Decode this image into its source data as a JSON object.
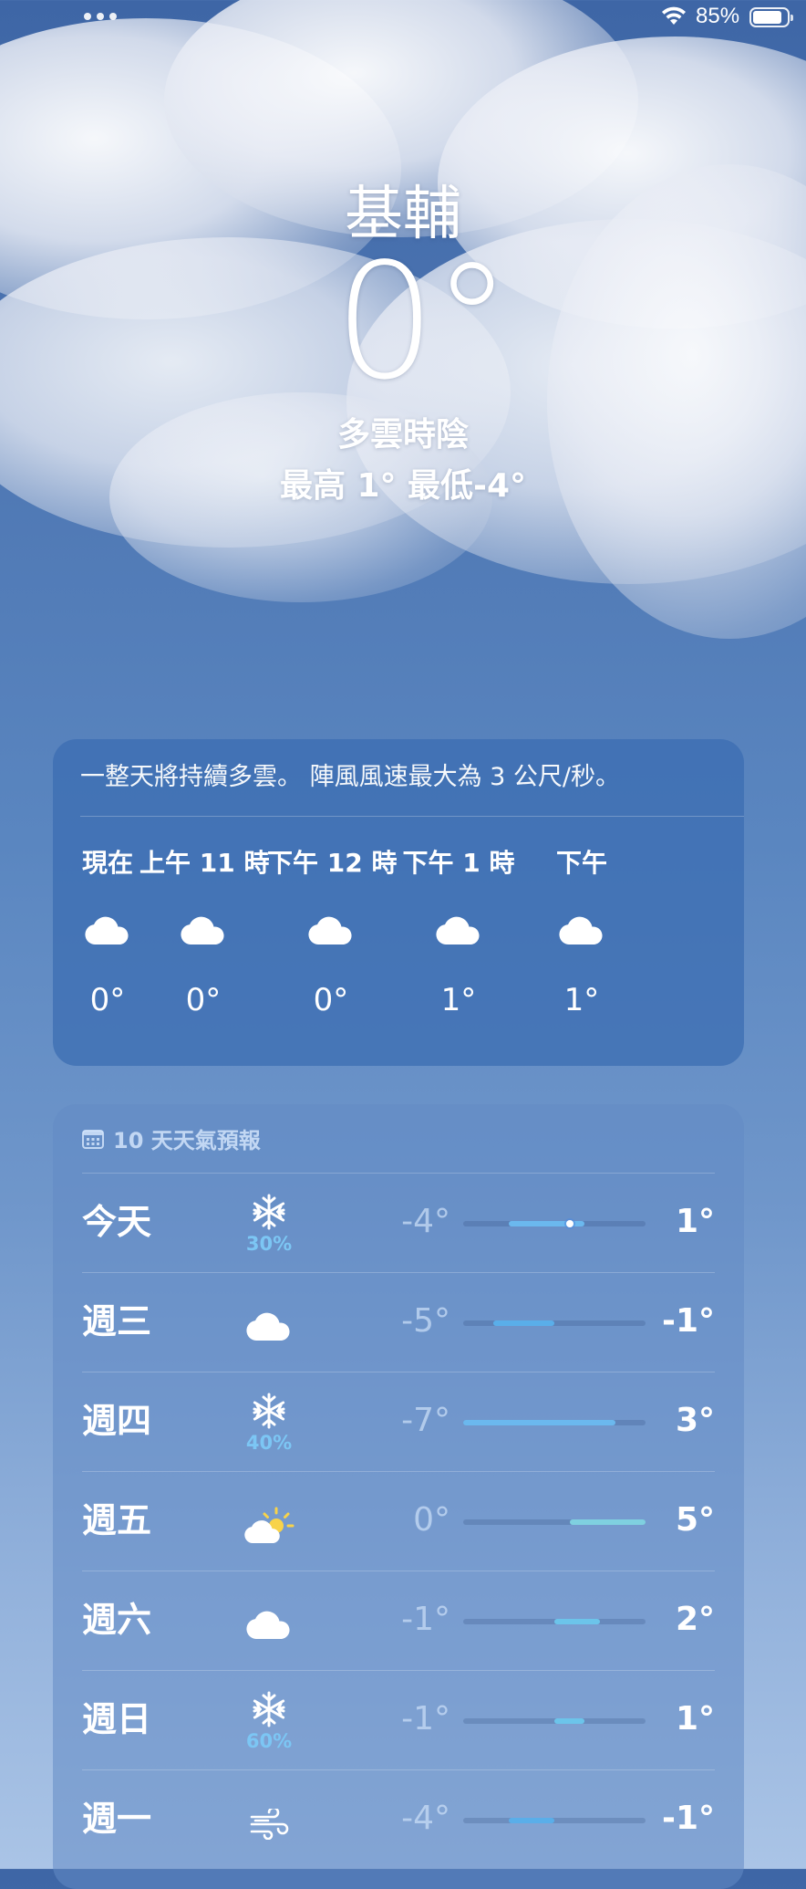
{
  "status_bar": {
    "battery_text": "85%",
    "battery_level": 0.85
  },
  "hero": {
    "city": "基輔",
    "temperature": "0°",
    "condition": "多雲時陰",
    "hi_lo": "最高 1°  最低-4°"
  },
  "hourly": {
    "summary": "一整天將持續多雲。 陣風風速最大為 3 公尺/秒。",
    "items": [
      {
        "label": "現在",
        "icon": "cloud-icon",
        "temp": "0°"
      },
      {
        "label": "上午 11 時",
        "icon": "cloud-icon",
        "temp": "0°"
      },
      {
        "label": "下午 12 時",
        "icon": "cloud-icon",
        "temp": "0°"
      },
      {
        "label": "下午 1 時",
        "icon": "cloud-icon",
        "temp": "1°"
      },
      {
        "label": "下午",
        "icon": "cloud-icon",
        "temp": "1°"
      }
    ]
  },
  "daily": {
    "header": "10 天天氣預報",
    "range_min": -7,
    "range_max": 5,
    "rows": [
      {
        "day": "今天",
        "icon": "snowflake-icon",
        "pct": "30%",
        "lo": "-4°",
        "hi": "1°",
        "lo_val": -4,
        "hi_val": 1,
        "current": 0,
        "color": "#6bb8ee"
      },
      {
        "day": "週三",
        "icon": "cloud-icon",
        "pct": "",
        "lo": "-5°",
        "hi": "-1°",
        "lo_val": -5,
        "hi_val": -1,
        "color": "#5aaee9"
      },
      {
        "day": "週四",
        "icon": "snowflake-icon",
        "pct": "40%",
        "lo": "-7°",
        "hi": "3°",
        "lo_val": -7,
        "hi_val": 3,
        "color": "#6bb8ee"
      },
      {
        "day": "週五",
        "icon": "partly-sunny-icon",
        "pct": "",
        "lo": "0°",
        "hi": "5°",
        "lo_val": 0,
        "hi_val": 5,
        "color": "#7fd0e0"
      },
      {
        "day": "週六",
        "icon": "cloud-icon",
        "pct": "",
        "lo": "-1°",
        "hi": "2°",
        "lo_val": -1,
        "hi_val": 2,
        "color": "#6cc4ea"
      },
      {
        "day": "週日",
        "icon": "snowflake-icon",
        "pct": "60%",
        "lo": "-1°",
        "hi": "1°",
        "lo_val": -1,
        "hi_val": 1,
        "color": "#6cc4ea"
      },
      {
        "day": "週一",
        "icon": "wind-icon",
        "pct": "",
        "lo": "-4°",
        "hi": "-1°",
        "lo_val": -4,
        "hi_val": -1,
        "color": "#5aaee9"
      }
    ]
  }
}
